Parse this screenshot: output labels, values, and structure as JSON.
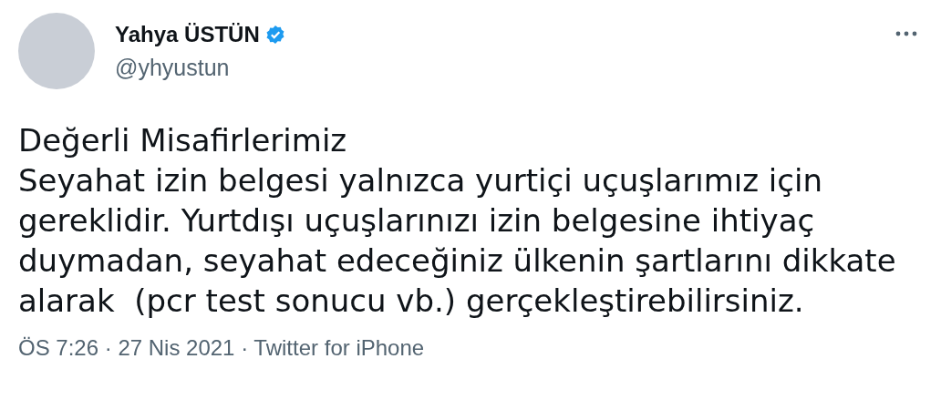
{
  "author": {
    "name": "Yahya ÜSTÜN",
    "handle": "@yhyustun",
    "verified": true
  },
  "tweet": {
    "text": "Değerli Misafirlerimiz\nSeyahat izin belgesi yalnızca yurtiçi uçuşlarımız için\ngereklidir. Yurtdışı uçuşlarınızı izin belgesine ihtiyaç\nduymadan, seyahat edeceğiniz ülkenin şartlarını dikkate\nalarak  (pcr test sonucu vb.) gerçekleştirebilirsiniz."
  },
  "meta": {
    "line": "ÖS 7:26 · 27 Nis 2021 · Twitter for iPhone"
  }
}
